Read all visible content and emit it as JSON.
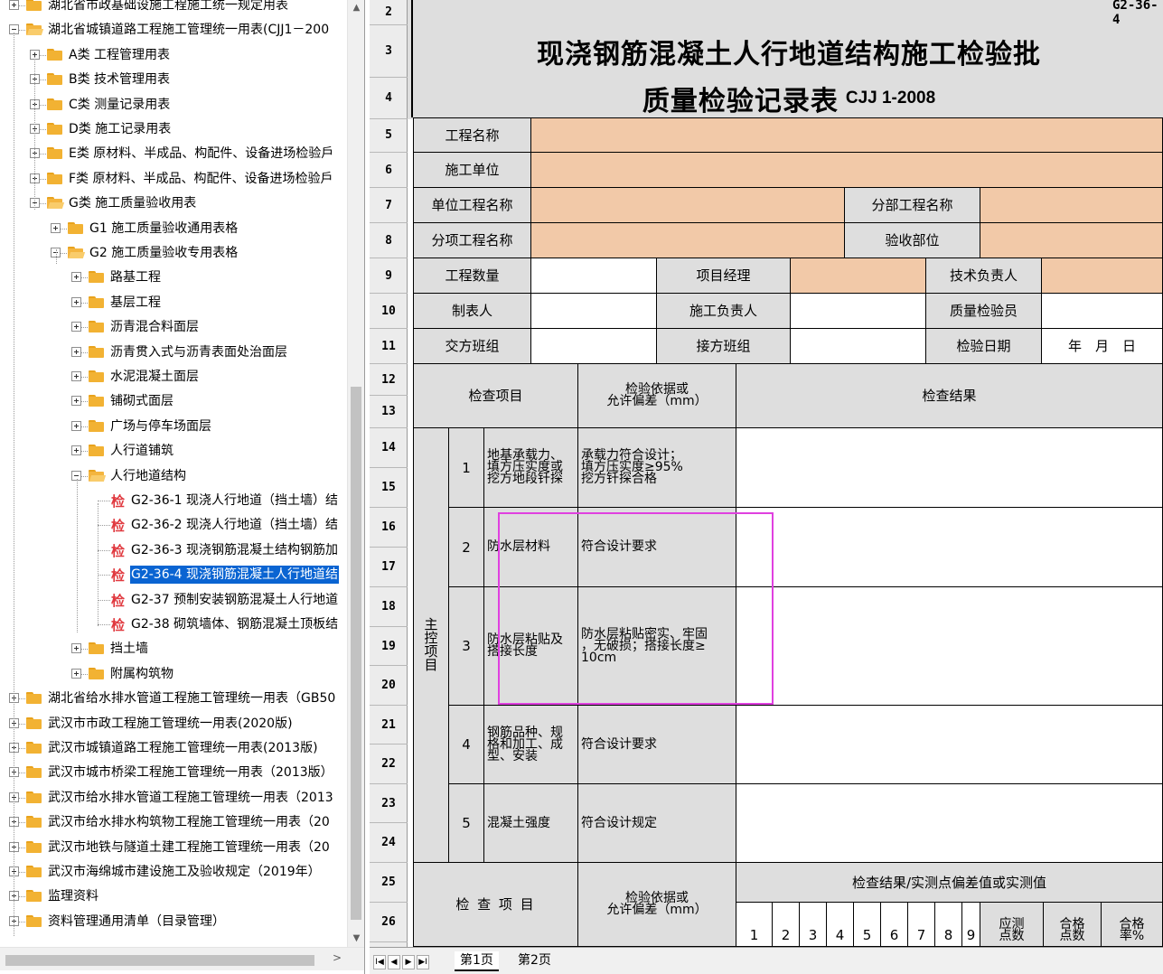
{
  "tree": {
    "nodes": [
      {
        "level": 0,
        "expander": "plus",
        "icon": "folder",
        "label": "湖北省市政基础设施工程施工统一规定用表"
      },
      {
        "level": 0,
        "expander": "minus",
        "icon": "folder-open",
        "label": "湖北省城镇道路工程施工管理统一用表(CJJ1－200"
      },
      {
        "level": 1,
        "expander": "plus",
        "icon": "folder",
        "label": "A类 工程管理用表"
      },
      {
        "level": 1,
        "expander": "plus",
        "icon": "folder",
        "label": "B类 技术管理用表"
      },
      {
        "level": 1,
        "expander": "plus",
        "icon": "folder",
        "label": "C类 测量记录用表"
      },
      {
        "level": 1,
        "expander": "plus",
        "icon": "folder",
        "label": "D类 施工记录用表"
      },
      {
        "level": 1,
        "expander": "plus",
        "icon": "folder",
        "label": "E类 原材料、半成品、构配件、设备进场检验戶"
      },
      {
        "level": 1,
        "expander": "plus",
        "icon": "folder",
        "label": "F类 原材料、半成品、构配件、设备进场检验戶"
      },
      {
        "level": 1,
        "expander": "minus",
        "icon": "folder-open",
        "label": "G类 施工质量验收用表"
      },
      {
        "level": 2,
        "expander": "plus",
        "icon": "folder",
        "label": "G1 施工质量验收通用表格"
      },
      {
        "level": 2,
        "expander": "minus",
        "icon": "folder-open",
        "label": "G2 施工质量验收专用表格"
      },
      {
        "level": 3,
        "expander": "plus",
        "icon": "folder",
        "label": "路基工程"
      },
      {
        "level": 3,
        "expander": "plus",
        "icon": "folder",
        "label": "基层工程"
      },
      {
        "level": 3,
        "expander": "plus",
        "icon": "folder",
        "label": "沥青混合料面层"
      },
      {
        "level": 3,
        "expander": "plus",
        "icon": "folder",
        "label": "沥青贯入式与沥青表面处治面层"
      },
      {
        "level": 3,
        "expander": "plus",
        "icon": "folder",
        "label": "水泥混凝土面层"
      },
      {
        "level": 3,
        "expander": "plus",
        "icon": "folder",
        "label": "铺砌式面层"
      },
      {
        "level": 3,
        "expander": "plus",
        "icon": "folder",
        "label": "广场与停车场面层"
      },
      {
        "level": 3,
        "expander": "plus",
        "icon": "folder",
        "label": "人行道铺筑"
      },
      {
        "level": 3,
        "expander": "minus",
        "icon": "folder-open",
        "label": "人行地道结构"
      },
      {
        "level": 4,
        "expander": "none",
        "icon": "form",
        "label": "G2-36-1 现浇人行地道（挡土墙）结"
      },
      {
        "level": 4,
        "expander": "none",
        "icon": "form",
        "label": "G2-36-2 现浇人行地道（挡土墙）结"
      },
      {
        "level": 4,
        "expander": "none",
        "icon": "form",
        "label": "G2-36-3 现浇钢筋混凝土结构钢筋加"
      },
      {
        "level": 4,
        "expander": "none",
        "icon": "form",
        "label": "G2-36-4 现浇钢筋混凝土人行地道结",
        "selected": true
      },
      {
        "level": 4,
        "expander": "none",
        "icon": "form",
        "label": "G2-37 预制安装钢筋混凝土人行地道"
      },
      {
        "level": 4,
        "expander": "none",
        "icon": "form",
        "label": "G2-38 砌筑墙体、钢筋混凝土顶板结"
      },
      {
        "level": 3,
        "expander": "plus",
        "icon": "folder",
        "label": "挡土墙"
      },
      {
        "level": 3,
        "expander": "plus",
        "icon": "folder",
        "label": "附属构筑物"
      },
      {
        "level": 0,
        "expander": "plus",
        "icon": "folder",
        "label": "湖北省给水排水管道工程施工管理统一用表（GB50"
      },
      {
        "level": 0,
        "expander": "plus",
        "icon": "folder",
        "label": "武汉市市政工程施工管理统一用表(2020版)"
      },
      {
        "level": 0,
        "expander": "plus",
        "icon": "folder",
        "label": "武汉市城镇道路工程施工管理统一用表(2013版)"
      },
      {
        "level": 0,
        "expander": "plus",
        "icon": "folder",
        "label": "武汉市城市桥梁工程施工管理统一用表（2013版）"
      },
      {
        "level": 0,
        "expander": "plus",
        "icon": "folder",
        "label": "武汉市给水排水管道工程施工管理统一用表（2013"
      },
      {
        "level": 0,
        "expander": "plus",
        "icon": "folder",
        "label": "武汉市给水排水构筑物工程施工管理统一用表（20"
      },
      {
        "level": 0,
        "expander": "plus",
        "icon": "folder",
        "label": "武汉市地铁与隧道土建工程施工管理统一用表（20"
      },
      {
        "level": 0,
        "expander": "plus",
        "icon": "folder",
        "label": "武汉市海绵城市建设施工及验收规定（2019年）"
      },
      {
        "level": 0,
        "expander": "plus",
        "icon": "folder",
        "label": "监理资料"
      },
      {
        "level": 0,
        "expander": "plus",
        "icon": "folder",
        "label": "资料管理通用清单（目录管理）"
      }
    ],
    "form_icon_glyph": "检",
    "scroll_up": "▲",
    "scroll_down": "▼",
    "scroll_left": "<",
    "scroll_right": ">"
  },
  "sheet": {
    "row_numbers": [
      "2",
      "3",
      "4",
      "5",
      "6",
      "7",
      "8",
      "9",
      "10",
      "11",
      "12",
      "13",
      "14",
      "15",
      "16",
      "17",
      "18",
      "19",
      "20",
      "21",
      "22",
      "23",
      "24",
      "25",
      "26"
    ],
    "code": "G2-36-4",
    "title_line1": "现浇钢筋混凝土人行地道结构施工检验批",
    "title_line2": "质量检验记录表",
    "standard": "CJJ 1-2008",
    "info": {
      "project_name": "工程名称",
      "construction_unit": "施工单位",
      "unit_project": "单位工程名称",
      "division_project": "分部工程名称",
      "subitem_project": "分项工程名称",
      "acceptance_part": "验收部位",
      "quantity": "工程数量",
      "project_manager": "项目经理",
      "technical_lead": "技术负责人",
      "prepared_by": "制表人",
      "construction_lead": "施工负责人",
      "qc_inspector": "质量检验员",
      "handover_team": "交方班组",
      "takeover_team": "接方班组",
      "inspection_date": "检验日期",
      "date_value": "年　月　日"
    },
    "header": {
      "item": "检查项目",
      "basis": "检验依据或\n允许偏差（mm）",
      "result": "检查结果"
    },
    "main_control_label": "主\n控\n项\n目",
    "items": [
      {
        "no": "1",
        "name": "地基承载力、\n填方压实度或\n挖方地段钎探",
        "basis": "承载力符合设计；\n填方压实度≥95%\n挖方钎探合格"
      },
      {
        "no": "2",
        "name": "防水层材料",
        "basis": "符合设计要求"
      },
      {
        "no": "3",
        "name": "防水层粘贴及\n搭接长度",
        "basis": "防水层粘贴密实、牢固\n，无破损；搭接长度≥\n10cm"
      },
      {
        "no": "4",
        "name": "钢筋品种、规\n格和加工、成\n型、安装",
        "basis": "符合设计要求"
      },
      {
        "no": "5",
        "name": "混凝土强度",
        "basis": "符合设计规定"
      }
    ],
    "general": {
      "item": "检 查 项 目",
      "basis": "检验依据或\n允许偏差（mm）",
      "result": "检查结果/实测点偏差值或实测值",
      "points": [
        "1",
        "2",
        "3",
        "4",
        "5",
        "6",
        "7",
        "8",
        "9"
      ],
      "should_measure": "应测\n点数",
      "qualified_points": "合格\n点数",
      "qualified_rate": "合格\n率%"
    },
    "tabs": [
      "第1页",
      "第2页"
    ],
    "nav_buttons": [
      "I◀",
      "◀",
      "▶",
      "▶I"
    ]
  }
}
